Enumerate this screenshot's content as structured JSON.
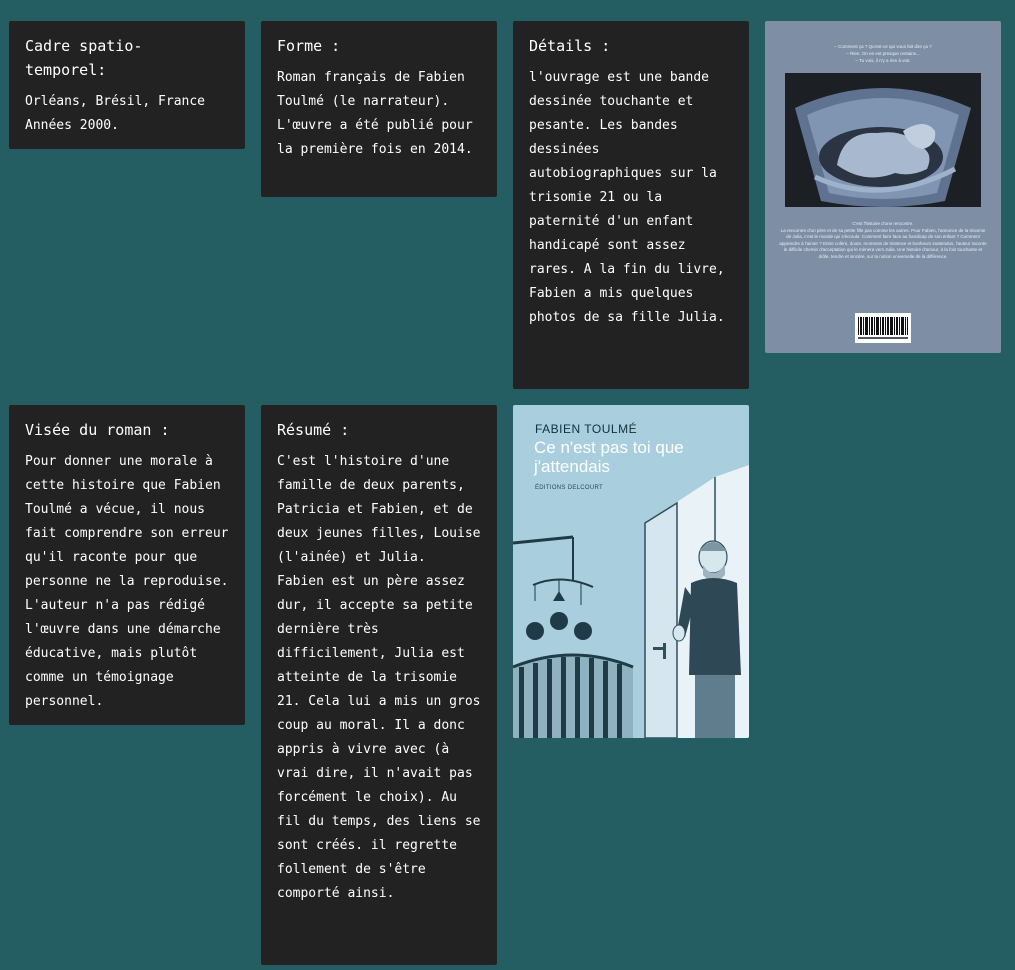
{
  "cards": {
    "cadre": {
      "title": "Cadre spatio-\ntemporel:",
      "body": "Orléans, Brésil, France Années 2000."
    },
    "forme": {
      "title": "Forme :",
      "body": "Roman français de Fabien Toulmé (le narrateur). L'œuvre a été publié pour la première fois en 2014."
    },
    "details": {
      "title": "Détails :",
      "body": "l'ouvrage est une bande dessinée touchante et pesante. Les bandes dessinées autobiographiques sur la trisomie 21 ou la paternité d'un enfant handicapé sont assez rares. A la fin du livre, Fabien a mis quelques photos de sa fille Julia."
    },
    "visee": {
      "title": "Visée du roman :",
      "body": "Pour donner une morale à cette histoire que Fabien Toulmé a vécue, il nous fait comprendre son erreur qu'il raconte pour que personne ne la reproduise. L'auteur n'a pas rédigé l'œuvre dans une démarche éducative, mais plutôt comme un témoignage personnel."
    },
    "resume": {
      "title": "Résumé :",
      "body": "C'est l'histoire d'une famille de deux parents, Patricia et Fabien, et de deux jeunes filles, Louise (l'ainée) et Julia.\nFabien est un père assez dur, il accepte sa petite dernière très difficilement, Julia est atteinte de la trisomie 21. Cela lui a mis un gros coup au moral. Il a donc appris à vivre avec (à vrai dire, il n'avait pas forcément le choix). Au fil du temps, des liens se sont créés. il regrette follement de s'être comporté ainsi."
    }
  },
  "back_cover": {
    "blurb_top": "– Comment ça ? Qu'est-ce qui vous fait dire ça ?\n– Rien. On en est presque certains...\n– Tu vois, il n'y a rien à voir.",
    "blurb_bottom": "C'est l'histoire d'une rencontre.\nLa rencontre d'un père et de sa petite fille pas comme les autres. Pour Fabien, l'annonce de la trisomie de Julia, c'est le monde qui s'écroule. Comment faire face au handicap de son enfant ? Comment apprendre à l'aimer ? Entre colère, doute, moments de tristesse et bonheurs inattendus, l'auteur raconte le difficile chemin d'acceptation qui le mènera vers Julia. Une histoire d'amour, à la fois touchante et drôle, tendre et sincère, sur la notion universelle de la différence.",
    "barcode_icon": "barcode-icon",
    "ultrasound_icon": "ultrasound-image-icon"
  },
  "front_cover": {
    "author": "FABIEN TOULMÉ",
    "title": "Ce n'est pas toi que j'attendais",
    "publisher": "ÉDITIONS DELCOURT",
    "illustration_icon": "father-at-door-illustration"
  },
  "colors": {
    "page_background": "#245e63",
    "card_background": "#222222",
    "card_text": "#ffffff"
  }
}
